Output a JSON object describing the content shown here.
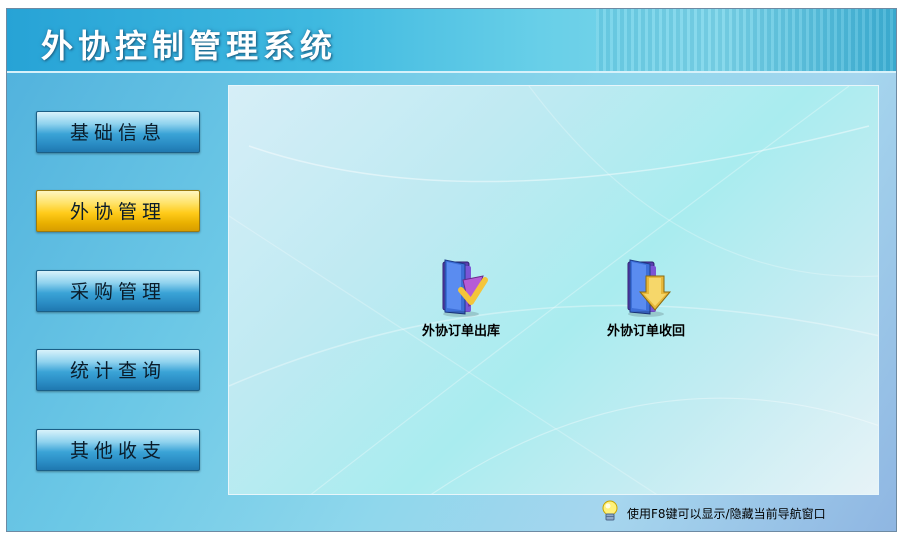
{
  "app": {
    "title": "外协控制管理系统"
  },
  "sidebar": {
    "items": [
      {
        "label": "基础信息",
        "active": false
      },
      {
        "label": "外协管理",
        "active": true
      },
      {
        "label": "采购管理",
        "active": false
      },
      {
        "label": "统计查询",
        "active": false
      },
      {
        "label": "其他收支",
        "active": false
      }
    ]
  },
  "main": {
    "shortcuts": [
      {
        "label": "外协订单出库",
        "icon": "folder-outbound-icon"
      },
      {
        "label": "外协订单收回",
        "icon": "folder-inbound-icon"
      }
    ]
  },
  "status": {
    "tip": "使用F8键可以显示/隐藏当前导航窗口",
    "icon": "lightbulb-icon"
  },
  "colors": {
    "accent_active": "#ffcb1a",
    "button_blue": "#2a8cc4",
    "header": "#3fb9e0"
  }
}
